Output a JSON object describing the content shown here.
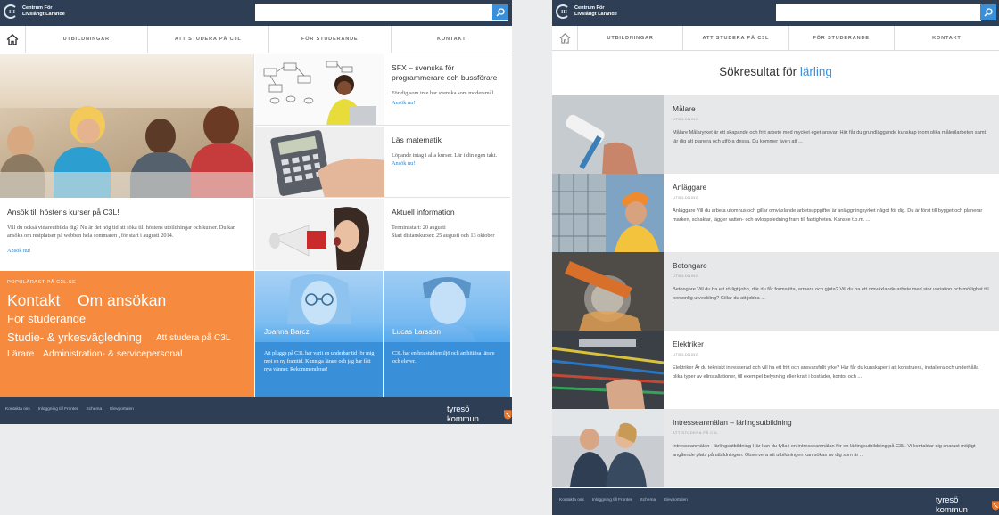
{
  "left_page": {
    "logo": {
      "line1": "Centrum För",
      "line2": "Livslångt Lärande",
      "mark": "III"
    },
    "search": {
      "value": "",
      "placeholder": ""
    },
    "nav": [
      {
        "label": "UTBILDNINGAR"
      },
      {
        "label": "ATT STUDERA PÅ C3L"
      },
      {
        "label": "FÖR STUDERANDE"
      },
      {
        "label": "KONTAKT"
      }
    ],
    "hero": {
      "title": "Ansök till höstens kurser på C3L!",
      "desc": "Vill du också vidareutbilda dig? Nu är det hög tid att söka till höstens utbildningar och kurser. Du kan ansöka om restplatser på webben hela sommaren , för start i augusti 2014.",
      "link": "Ansök nu!"
    },
    "features": [
      {
        "title": "SFX – svenska för programmerare och bussförare",
        "desc": "För dig som inte har svenska som modersmål.",
        "link": "Ansök nu!"
      },
      {
        "title": "Läs matematik",
        "desc": "Löpande intag i alla kurser. Lär i din egen takt.",
        "link": "Ansök nu!"
      },
      {
        "title": "Aktuell information",
        "desc": "Terminsstart: 20 augusti\nStart distanskurser: 25 augusti och 13 oktober",
        "link": ""
      }
    ],
    "popular": {
      "label": "POPULÄRAST PÅ C3L.SE",
      "tags": [
        "Kontakt",
        "Om ansökan",
        "För studerande",
        "Studie- & yrkesvägledning",
        "Att studera på C3L",
        "Lärare",
        "Administration- & servicepersonal"
      ]
    },
    "testimonials": [
      {
        "name": "Joanna Barcz",
        "quote": "Att plugga på C3L har varit en underbar tid för mig mot en ny framtid. Kunniga lärare och jag har fått nya vänner. Rekommenderas!"
      },
      {
        "name": "Lucas Larsson",
        "quote": "C3L har en bra studiemiljö och ambitiösa lärare och elever."
      }
    ],
    "footer": {
      "links": [
        "Kontakta oss",
        "Inloggning till Fronter",
        "Schema",
        "Elevportalen"
      ],
      "brand": "tyresö kommun"
    }
  },
  "right_page": {
    "logo": {
      "line1": "Centrum För",
      "line2": "Livslångt Lärande",
      "mark": "III"
    },
    "search": {
      "value": "",
      "placeholder": ""
    },
    "nav": [
      {
        "label": "UTBILDNINGAR"
      },
      {
        "label": "ATT STUDERA PÅ C3L"
      },
      {
        "label": "FÖR STUDERANDE"
      },
      {
        "label": "KONTAKT"
      }
    ],
    "results_heading": {
      "prefix": "Sökresultat för",
      "query": "lärling"
    },
    "results": [
      {
        "title": "Målare",
        "category": "UTBILDNING",
        "desc": "Målare Målaryrket är ett skapande och fritt arbete med mycket eget ansvar. Här får du grundläggande kunskap inom olika målerilarbeten samt lär dig att planera och utföra dessa. Du kommer även att ..."
      },
      {
        "title": "Anläggare",
        "category": "UTBILDNING",
        "desc": "Anläggare Vill du arbeta utomhus och gillar omväxlande arbetsuppgifter är anläggningsyrket något för dig. Du är först till bygget och planerar marken, schaktar, lägger vatten- och avloppsledning fram till fastigheten. Kanske t.o.m. ..."
      },
      {
        "title": "Betongare",
        "category": "UTBILDNING",
        "desc": "Betongare Vill du ha ett rörligt jobb, där du får formsätta, armera och gjuta? Vill du ha ett omväxlande arbete med stor variation och möjlighet till personlig utveckling? Gillar du att jobba ..."
      },
      {
        "title": "Elektriker",
        "category": "UTBILDNING",
        "desc": "Elektriker Är du tekniskt intresserad och vill ha ett fritt och ansvarsfullt yrke? Här får du kunskaper i att konstruera, installera och underhålla olika typer av elinstallationer, till exempel belysning eller kraft i bostäder, kontor och ..."
      },
      {
        "title": "Intresseanmälan – lärlingsutbildning",
        "category": "ATT STUDERA PÅ C3L",
        "desc": "Intresseanmälan - lärlingsutbildning Här kan du fylla i en intresseanmälan för en lärlingsutbildning på C3L. Vi kontaktar dig snarast möjligt angående plats på utbildningen.  Observera att utbildningen kan sökas av dig som är ..."
      }
    ],
    "footer": {
      "links": [
        "Kontakta oss",
        "Inloggning till Fronter",
        "Schema",
        "Elevportalen"
      ],
      "brand": "tyresö kommun"
    }
  },
  "colors": {
    "navy": "#2e3f55",
    "blue": "#3a8fd9",
    "orange": "#f68a3e",
    "light_blue": "#4fa6ec"
  }
}
